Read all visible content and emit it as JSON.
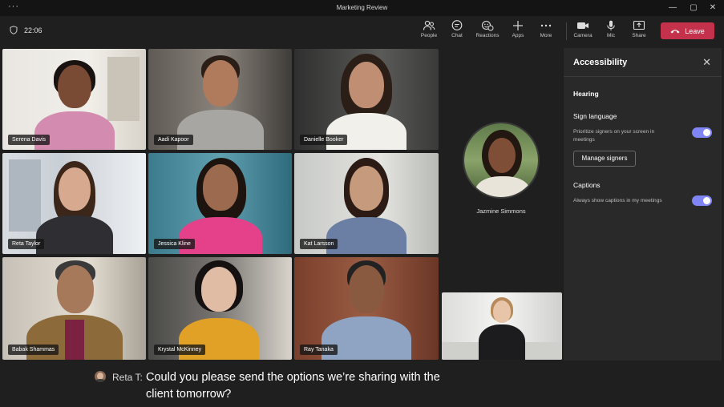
{
  "window": {
    "title": "Marketing Review",
    "menu_icon": "more-dots-icon"
  },
  "meeting": {
    "elapsed": "22:06"
  },
  "toolbar": {
    "people": "People",
    "chat": "Chat",
    "reactions": "Reactions",
    "apps": "Apps",
    "more": "More",
    "camera": "Camera",
    "mic": "Mic",
    "share": "Share",
    "leave": "Leave",
    "leave_color": "#c4314b"
  },
  "participants": [
    {
      "name": "Serena Davis"
    },
    {
      "name": "Aadi Kapoor"
    },
    {
      "name": "Danielle Booker"
    },
    {
      "name": "Reta Taylor"
    },
    {
      "name": "Jessica Kline"
    },
    {
      "name": "Kat Larsson"
    },
    {
      "name": "Babak Shammas"
    },
    {
      "name": "Krystal McKinney"
    },
    {
      "name": "Ray Tanaka"
    }
  ],
  "featured": {
    "name": "Jazmine Simmons"
  },
  "accessibility": {
    "title": "Accessibility",
    "hearing": "Hearing",
    "sign_language": "Sign language",
    "sign_language_desc_1": "Prioritize signers on your screen in",
    "sign_language_desc_2": "meetings",
    "sign_language_enabled": true,
    "manage_signers": "Manage signers",
    "captions": "Captions",
    "captions_desc": "Always show captions in my meetings",
    "captions_enabled": true,
    "accent_color": "#7f85f5"
  },
  "caption": {
    "speaker": "Reta T:",
    "line1": "Could you please send the options we’re sharing with the",
    "line2": "client tomorrow?"
  }
}
